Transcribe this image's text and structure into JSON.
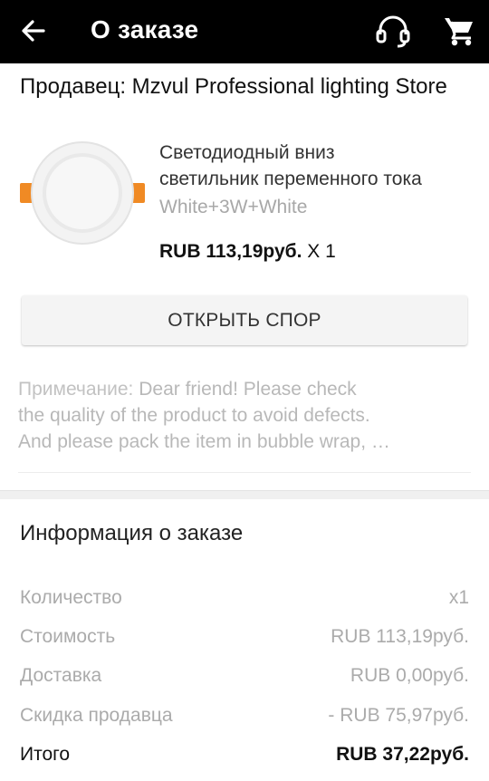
{
  "header": {
    "title": "О заказе",
    "back_icon": "arrow-left-icon",
    "support_icon": "headset-icon",
    "cart_icon": "cart-icon",
    "background": "#000000"
  },
  "seller": {
    "label": "Продавец: Mzvul Professional lighting Store"
  },
  "product": {
    "image_icon": "downlight-product-image",
    "title_line1": "Светодиодный вниз",
    "title_line2": "светильник переменного тока",
    "variant": "White+3W+White",
    "price": "RUB 113,19руб.",
    "quantity": "X 1"
  },
  "dispute_button": "ОТКРЫТЬ СПОР",
  "note": {
    "label": "Примечание:",
    "line1": " Dear friend! Please check",
    "line2": "the quality of the product to avoid defects.",
    "line3": "And please pack the item in bubble wrap, …"
  },
  "order_info": {
    "title": "Информация о заказе",
    "rows": [
      {
        "label": "Количество",
        "value": "x1"
      },
      {
        "label": "Стоимость",
        "value": "RUB 113,19руб."
      },
      {
        "label": "Доставка",
        "value": "RUB 0,00руб."
      },
      {
        "label": "Скидка продавца",
        "value": "- RUB 75,97руб."
      },
      {
        "label": "Итого",
        "value": "RUB 37,22руб."
      }
    ]
  }
}
